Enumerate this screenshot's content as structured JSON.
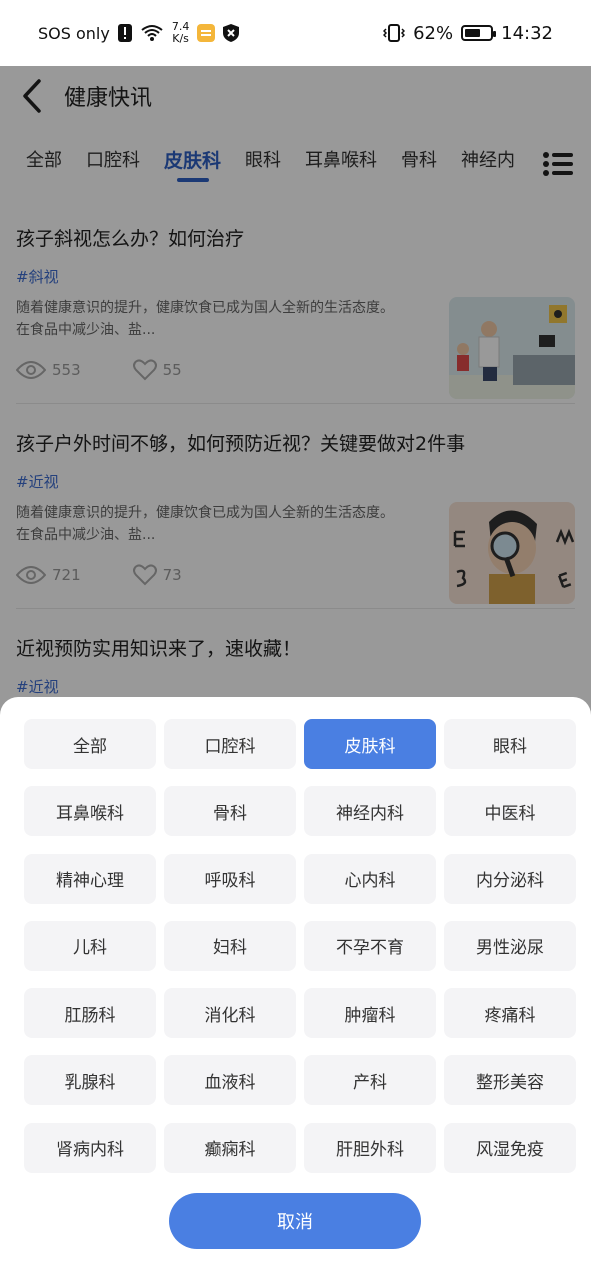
{
  "status_bar": {
    "carrier": "SOS only",
    "net_speed_value": "7.4",
    "net_speed_unit": "K/s",
    "battery_percent": "62%",
    "battery_level": 0.62,
    "time": "14:32"
  },
  "header": {
    "title": "健康快讯"
  },
  "tabs": [
    {
      "label": "全部"
    },
    {
      "label": "口腔科"
    },
    {
      "label": "皮肤科"
    },
    {
      "label": "眼科"
    },
    {
      "label": "耳鼻喉科"
    },
    {
      "label": "骨科"
    },
    {
      "label": "神经内"
    }
  ],
  "active_tab": "皮肤科",
  "articles": [
    {
      "title": "孩子斜视怎么办？如何治疗",
      "tag": "#斜视",
      "summary_line1": "随着健康意识的提升，健康饮食已成为国人全新的生活态度。",
      "summary_line2": "在食品中减少油、盐...",
      "views": "553",
      "likes": "55"
    },
    {
      "title": "孩子户外时间不够，如何预防近视？关键要做对2件事",
      "tag": "#近视",
      "summary_line1": "随着健康意识的提升，健康饮食已成为国人全新的生活态度。",
      "summary_line2": "在食品中减少油、盐...",
      "views": "721",
      "likes": "73"
    },
    {
      "title": "近视预防实用知识来了，速收藏！",
      "tag": "#近视"
    }
  ],
  "sheet": {
    "categories": [
      "全部",
      "口腔科",
      "皮肤科",
      "眼科",
      "耳鼻喉科",
      "骨科",
      "神经内科",
      "中医科",
      "精神心理",
      "呼吸科",
      "心内科",
      "内分泌科",
      "儿科",
      "妇科",
      "不孕不育",
      "男性泌尿",
      "肛肠科",
      "消化科",
      "肿瘤科",
      "疼痛科",
      "乳腺科",
      "血液科",
      "产科",
      "整形美容",
      "肾病内科",
      "癫痫科",
      "肝胆外科",
      "风湿免疫"
    ],
    "selected": "皮肤科",
    "cancel_label": "取消"
  },
  "colors": {
    "accent": "#4a7fe2",
    "tab_active": "#2d5fc4",
    "tag": "#3f6dd0"
  }
}
